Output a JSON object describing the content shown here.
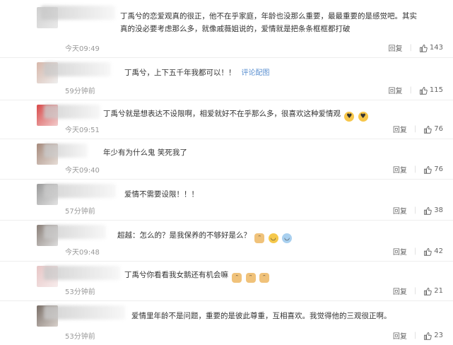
{
  "comments": [
    {
      "text": "丁禹兮的恋爱观真的很正，他不在乎家庭，年龄也没那么重要，最最重要的是感觉吧。其实真的没必要考虑那么多，就像戚薇姐说的，爱情就是把条条框框都打破",
      "line1": "丁禹兮的恋爱观真的很正，他不在乎家庭，年龄也没那么重要，最最重要的是感觉吧。其实",
      "line2": "真的没必要考虑那么多，就像戚薇姐说的，爱情就是把条条框框都打破",
      "time": "今天09:49",
      "reply": "回复",
      "likes": "143"
    },
    {
      "text": "丁禹兮，上下五千年我都可以！！",
      "link": "评论配图",
      "time": "59分钟前",
      "reply": "回复",
      "likes": "115"
    },
    {
      "text": "丁禹兮就是想表达不设限啊，相爱就好不在乎那么多，很喜欢这种爱情观",
      "time": "今天09:51",
      "reply": "回复",
      "likes": "76"
    },
    {
      "text": "年少有为什么鬼 笑死我了",
      "time": "今天09:40",
      "reply": "回复",
      "likes": "76"
    },
    {
      "text": "爱情不需要设限！！！",
      "time": "57分钟前",
      "reply": "回复",
      "likes": "38"
    },
    {
      "text": "超越：怎么的？是我保养的不够好是么？",
      "time": "今天09:48",
      "reply": "回复",
      "likes": "42"
    },
    {
      "text": "丁禹兮你看看我女鹅还有机会嘛",
      "time": "53分钟前",
      "reply": "回复",
      "likes": "21"
    },
    {
      "text": "爱情里年龄不是问题，重要的是彼此尊重，互相喜欢。我觉得他的三观很正啊。",
      "time": "53分钟前",
      "reply": "回复",
      "likes": "23"
    }
  ],
  "icons": {
    "like": "thumbs-up-icon",
    "emoji_love": "heart-eyes-emoji",
    "emoji_cat": "cat-face-emoji",
    "emoji_laugh": "laughing-emoji",
    "emoji_sweat": "sweat-smile-emoji"
  },
  "colors": {
    "link": "#5a8fd0",
    "time": "#999999",
    "text": "#333333"
  }
}
